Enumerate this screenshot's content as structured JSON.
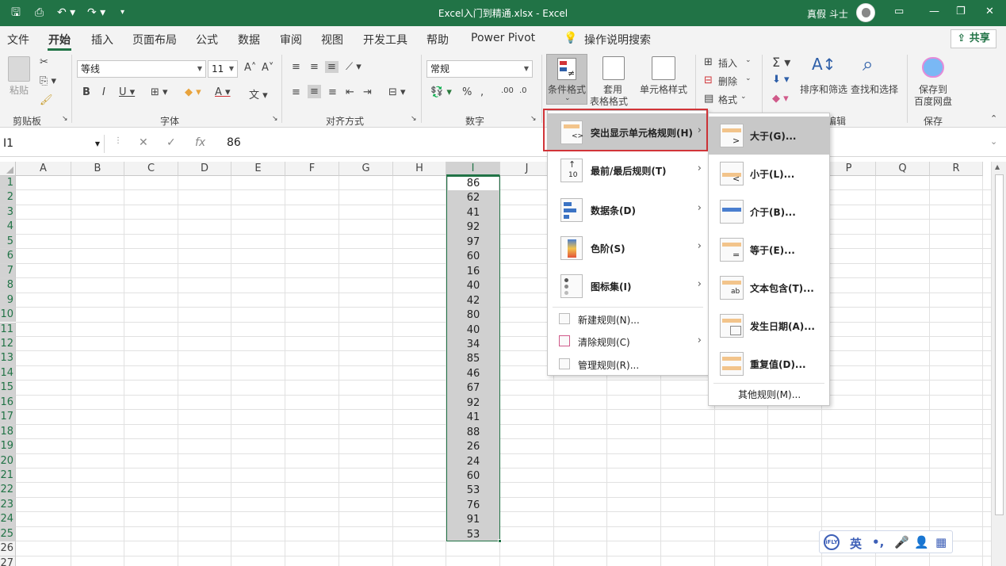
{
  "titlebar": {
    "title": "Excel入门到精通.xlsx  -  Excel",
    "user": "真假 斗士"
  },
  "tabs": [
    "文件",
    "开始",
    "插入",
    "页面布局",
    "公式",
    "数据",
    "审阅",
    "视图",
    "开发工具",
    "帮助",
    "Power Pivot"
  ],
  "search_label": "操作说明搜索",
  "share_label": "共享",
  "ribbon": {
    "paste": "粘贴",
    "font_name": "等线",
    "font_size": "11",
    "number_format": "常规",
    "conditional_format": "条件格式",
    "table_format_1": "套用",
    "table_format_2": "表格格式",
    "cell_style": "单元格样式",
    "insert": "插入",
    "delete": "删除",
    "format": "格式",
    "sort_filter": "排序和筛选",
    "find_select": "查找和选择",
    "save_to_1": "保存到",
    "save_to_2": "百度网盘",
    "groups": {
      "clipboard": "剪贴板",
      "font": "字体",
      "alignment": "对齐方式",
      "number": "数字",
      "editing_partial": "编辑",
      "save": "保存"
    }
  },
  "formula_bar": {
    "name_box": "I1",
    "value": "86"
  },
  "columns": [
    "A",
    "B",
    "C",
    "D",
    "E",
    "F",
    "G",
    "H",
    "I",
    "J",
    "K",
    "L",
    "M",
    "N",
    "O",
    "P",
    "Q",
    "R"
  ],
  "rows": [
    "1",
    "2",
    "3",
    "4",
    "5",
    "6",
    "7",
    "8",
    "9",
    "10",
    "11",
    "12",
    "13",
    "14",
    "15",
    "16",
    "17",
    "18",
    "19",
    "20",
    "21",
    "22",
    "23",
    "24",
    "25",
    "26",
    "27"
  ],
  "column_I_values": [
    "86",
    "62",
    "41",
    "92",
    "97",
    "60",
    "16",
    "40",
    "42",
    "80",
    "40",
    "34",
    "85",
    "46",
    "67",
    "92",
    "41",
    "88",
    "26",
    "24",
    "60",
    "53",
    "76",
    "91",
    "53"
  ],
  "cf_menu": {
    "items": [
      "突出显示单元格规则(H)",
      "最前/最后规则(T)",
      "数据条(D)",
      "色阶(S)",
      "图标集(I)"
    ],
    "small_items": [
      "新建规则(N)...",
      "清除规则(C)",
      "管理规则(R)..."
    ]
  },
  "submenu": {
    "items": [
      "大于(G)...",
      "小于(L)...",
      "介于(B)...",
      "等于(E)...",
      "文本包含(T)...",
      "发生日期(A)...",
      "重复值(D)..."
    ],
    "more": "其他规则(M)..."
  },
  "ime": {
    "lang": "英"
  },
  "colors": {
    "accent": "#217346",
    "highlight_box": "#d13438"
  }
}
